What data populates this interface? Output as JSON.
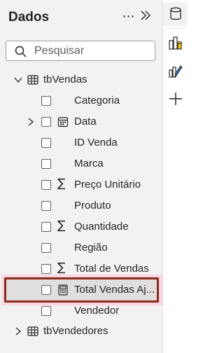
{
  "pane": {
    "title": "Dados",
    "more_label": "⋯",
    "search": {
      "placeholder": "Pesquisar",
      "value": ""
    }
  },
  "tables": [
    {
      "name": "tbVendas",
      "expanded": true,
      "fields": [
        {
          "name": "Categoria",
          "icon": "none",
          "expandable": false
        },
        {
          "name": "Data",
          "icon": "calendar-icon",
          "expandable": true
        },
        {
          "name": "ID Venda",
          "icon": "none",
          "expandable": false
        },
        {
          "name": "Marca",
          "icon": "none",
          "expandable": false
        },
        {
          "name": "Preço Unitário",
          "icon": "sigma-icon",
          "expandable": false
        },
        {
          "name": "Produto",
          "icon": "none",
          "expandable": false
        },
        {
          "name": "Quantidade",
          "icon": "sigma-icon",
          "expandable": false
        },
        {
          "name": "Região",
          "icon": "none",
          "expandable": false
        },
        {
          "name": "Total de Vendas",
          "icon": "sigma-icon",
          "expandable": false
        },
        {
          "name": "Total Vendas Aj...",
          "icon": "calculator-icon",
          "expandable": false,
          "highlighted": true
        },
        {
          "name": "Vendedor",
          "icon": "none",
          "expandable": false
        }
      ]
    },
    {
      "name": "tbVendedores",
      "expanded": false
    }
  ],
  "rail": {
    "buttons": [
      "database-icon",
      "build-visual-icon",
      "format-visual-icon",
      "plus-icon"
    ]
  },
  "colors": {
    "highlight_border": "#8b2a1c",
    "highlight_glow": "#f8d7e3",
    "pane_bg": "#f3f2f1"
  }
}
